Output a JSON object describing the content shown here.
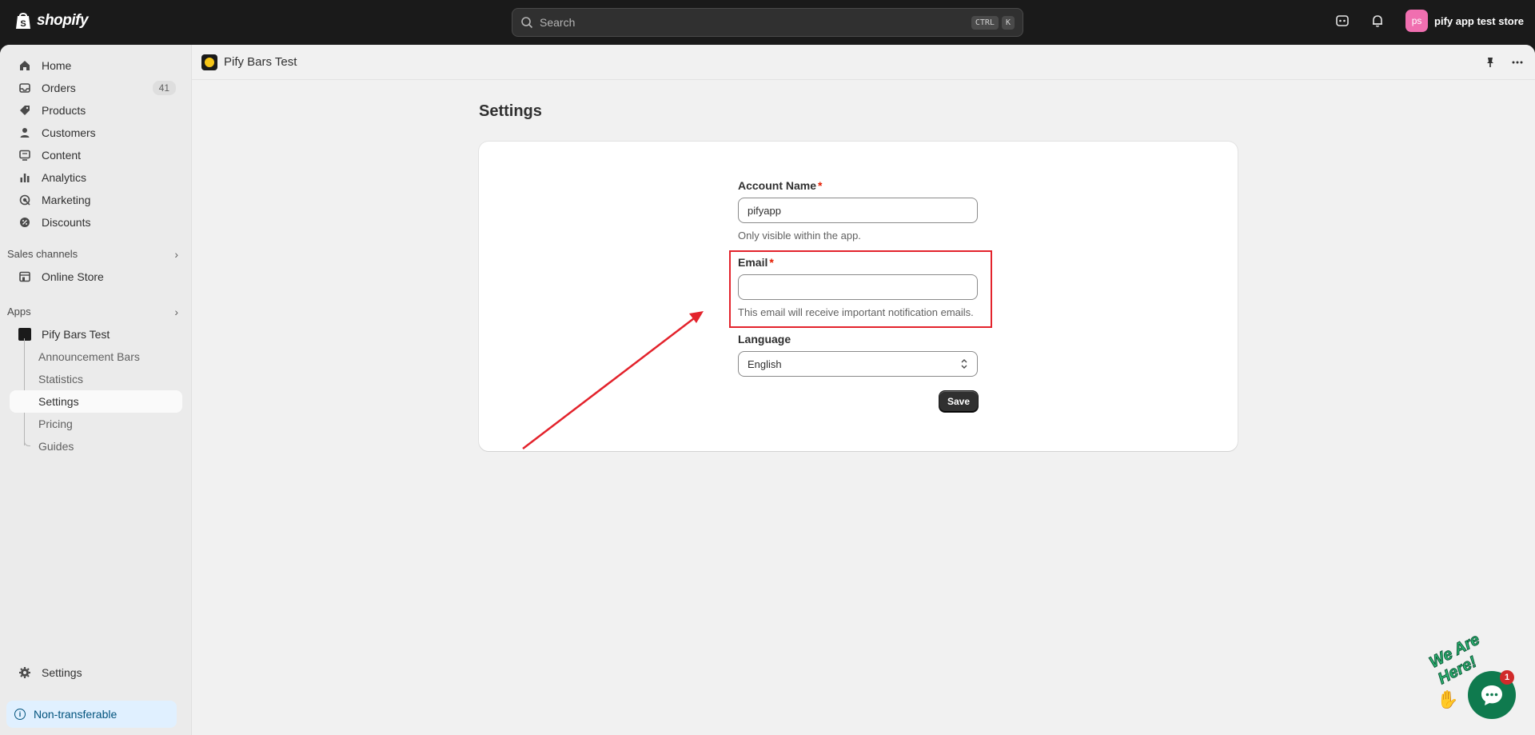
{
  "topbar": {
    "brand": "shopify",
    "search_placeholder": "Search",
    "shortcut_ctrl": "CTRL",
    "shortcut_key": "K",
    "store_initials": "ps",
    "store_name": "pify app test store"
  },
  "sidebar": {
    "items": [
      {
        "label": "Home",
        "icon": "home-icon"
      },
      {
        "label": "Orders",
        "icon": "orders-icon",
        "count": "41"
      },
      {
        "label": "Products",
        "icon": "tag-icon"
      },
      {
        "label": "Customers",
        "icon": "person-icon"
      },
      {
        "label": "Content",
        "icon": "content-icon"
      },
      {
        "label": "Analytics",
        "icon": "bar-chart-icon"
      },
      {
        "label": "Marketing",
        "icon": "target-icon"
      },
      {
        "label": "Discounts",
        "icon": "discount-icon"
      }
    ],
    "sales_channels_label": "Sales channels",
    "online_store": "Online Store",
    "apps_label": "Apps",
    "app_name": "Pify Bars Test",
    "app_sub_items": [
      "Announcement Bars",
      "Statistics",
      "Settings",
      "Pricing",
      "Guides"
    ],
    "active_sub_item": "Settings",
    "settings": "Settings",
    "non_transferable": "Non-transferable"
  },
  "appbar": {
    "title": "Pify Bars Test"
  },
  "page": {
    "title": "Settings",
    "account_name_label": "Account Name",
    "account_name_value": "pifyapp",
    "account_name_help": "Only visible within the app.",
    "email_label": "Email",
    "email_value": "",
    "email_help": "This email will receive important notification emails.",
    "language_label": "Language",
    "language_value": "English",
    "save_label": "Save",
    "required_mark": "*"
  },
  "chat_widget": {
    "tagline": "We Are Here!",
    "badge_count": "1"
  },
  "colors": {
    "topbar": "#1a1a1a",
    "highlight": "#e3232c",
    "chat": "#0f7a4e",
    "avatar": "#f06fb0"
  }
}
